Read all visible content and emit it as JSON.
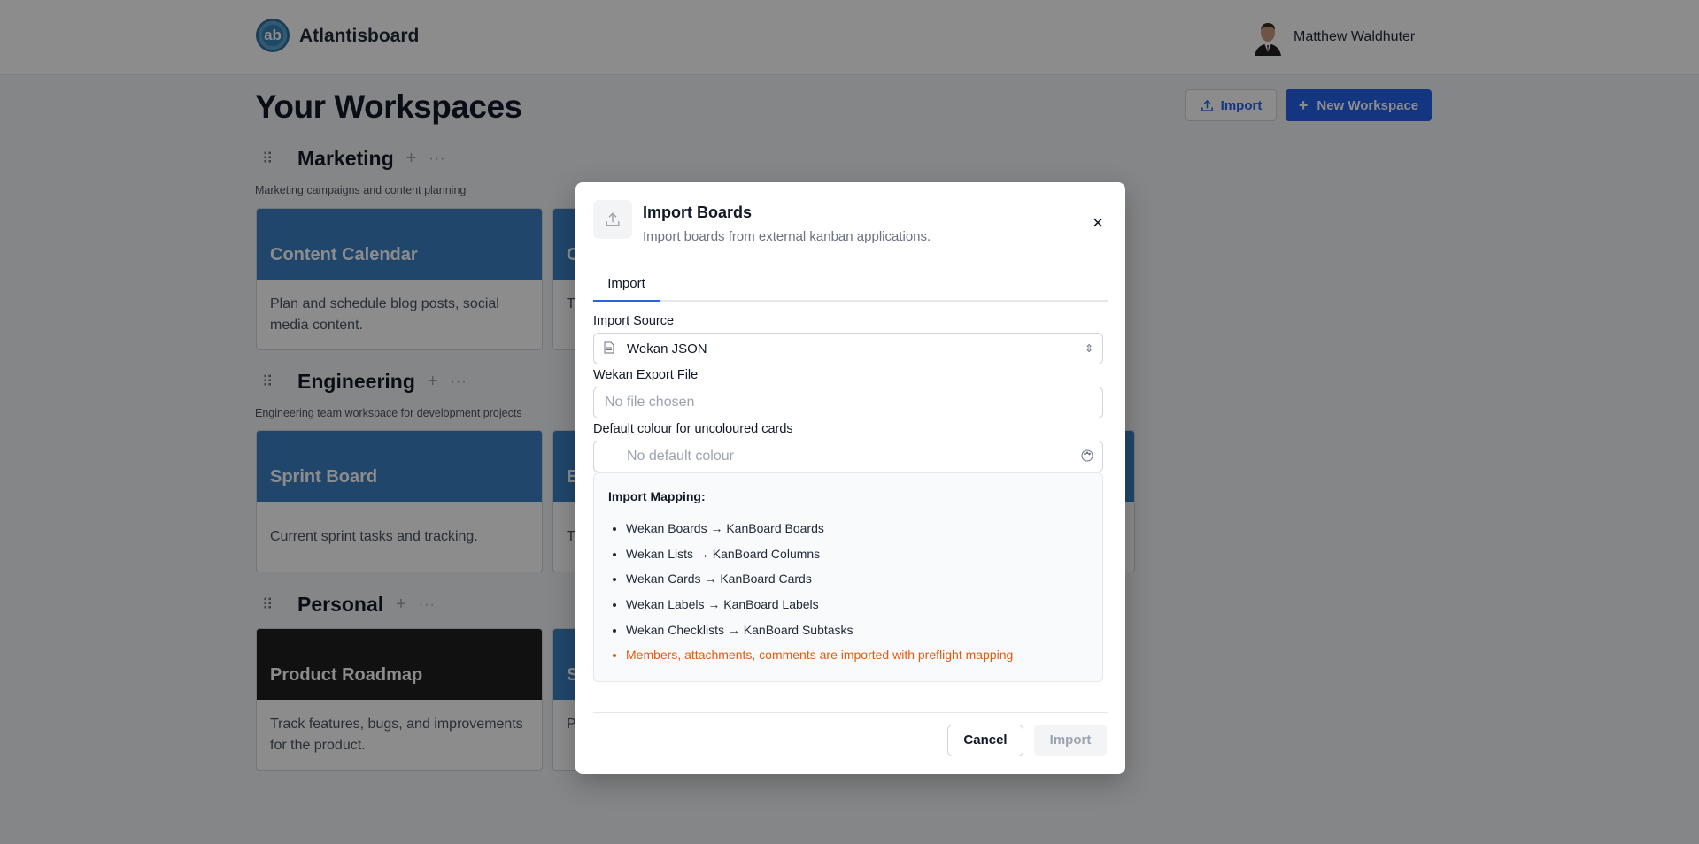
{
  "header": {
    "logo_text": "ab",
    "brand": "Atlantisboard",
    "user_name": "Matthew Waldhuter"
  },
  "main": {
    "title": "Your Workspaces",
    "import_label": "Import",
    "new_workspace_label": "New Workspace",
    "workspaces": [
      {
        "name": "Marketing",
        "description": "Marketing campaigns and content planning",
        "boards": [
          {
            "title": "Content Calendar",
            "description": "Plan and schedule blog posts, social media content.",
            "color": "#3b82c4"
          },
          {
            "title": "C",
            "description": "T p",
            "color": "#3b82c4"
          }
        ]
      },
      {
        "name": "Engineering",
        "description": "Engineering team workspace for development projects",
        "boards": [
          {
            "title": "Sprint Board",
            "description": "Current sprint tasks and tracking.",
            "color": "#3b82c4"
          },
          {
            "title": "E",
            "description": "T",
            "color": "#3b82c4"
          }
        ]
      },
      {
        "name": "Personal",
        "boards": [
          {
            "title": "Product Roadmap",
            "description": "Track features, bugs, and improvements for the product.",
            "color": "#1f1f1f"
          },
          {
            "title": "S",
            "description": "P e",
            "color": "#3b82c4"
          }
        ]
      }
    ]
  },
  "modal": {
    "title": "Import Boards",
    "subtitle": "Import boards from external kanban applications.",
    "tab": "Import",
    "source_label": "Import Source",
    "source_value": "Wekan JSON",
    "file_label": "Wekan Export File",
    "file_placeholder": "No file chosen",
    "colour_label": "Default colour for uncoloured cards",
    "colour_placeholder": "No default colour",
    "mapping_heading": "Import Mapping:",
    "mapping": [
      "Wekan Boards → KanBoard Boards",
      "Wekan Lists → KanBoard Columns",
      "Wekan Cards → KanBoard Cards",
      "Wekan Labels → KanBoard Labels",
      "Wekan Checklists → KanBoard Subtasks"
    ],
    "mapping_note": "Members, attachments, comments are imported with preflight mapping",
    "cancel_label": "Cancel",
    "import_label": "Import"
  },
  "colors": {
    "primary": "#2563eb",
    "warning": "#ea580c",
    "board_blue": "#3b82c4"
  }
}
